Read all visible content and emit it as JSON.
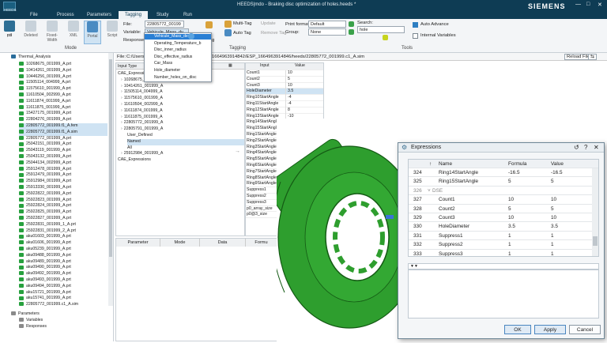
{
  "app": {
    "title": "HEEDS|mdo - Braking disc optimization of holes.heeds *",
    "logo_text": "HEEDS",
    "brand": "SIEMENS",
    "colors": {
      "titlebar": "#0e3c54",
      "accent": "#2a7fd4",
      "model": "#2e9e2e"
    }
  },
  "menu": {
    "tabs": [
      "File",
      "Process",
      "Parameters",
      "Tagging",
      "Study",
      "Run"
    ],
    "active": "Tagging"
  },
  "ribbon": {
    "mode": {
      "label": "Mode",
      "buttons": [
        "Deleted",
        "Fixed-Width",
        "XML",
        "Portal",
        "Script"
      ],
      "selected": "Portal",
      "left_buttons": [
        "rdi",
        "pxl"
      ]
    },
    "tagging": {
      "label": "Tagging",
      "file_label": "File:",
      "file_value": "22805772_00199",
      "variable_label": "Variable:",
      "variable_value": "Vehicule_Mass_dv",
      "response_label": "Response:",
      "tag_buttons": [
        "Tag",
        "Multi-Tag",
        "Update",
        "Auto Tag",
        "Remove Tag"
      ]
    },
    "tools": {
      "label": "Tools",
      "print_format_label": "Print format:",
      "print_format_value": "Default",
      "group_label": "Group:",
      "group_value": "None",
      "search_label": "Search:",
      "search_value": "hole",
      "auto_advance": "Auto Advance",
      "internal_variables": "Internal Variables"
    }
  },
  "dropdown": {
    "items": [
      "Vehicule_Mass_desi",
      "Operating_Temperature_b",
      "Disc_inner_radius",
      "Disc_effective_radius",
      "Car_Mass",
      "Hole_diameter",
      "Number_holes_on_disc"
    ],
    "selected": "Vehicule_Mass_desi"
  },
  "tree": {
    "root": "Thermal_Analysis",
    "items": [
      "10268675_001999_A.prt",
      "10414261_001999_A.prt",
      "10446256_001999_A.prt",
      "11505114_004999_A.prt",
      "11575610_001999_A.prt",
      "11610504_002999_A.prt",
      "11611874_001999_A.prt",
      "11611875_001999_A.prt",
      "15427175_001999_A.prt",
      "22804276_001999_A.prt",
      "22805772_001999.f1_A.fem",
      "22805772_001999.f1_A.sim",
      "22805772_001999_A.prt",
      "25042151_001999_A.prt",
      "25043119_001999_A.prt",
      "25043132_001999_A.prt",
      "25044134_002999_A.prt",
      "25912478_001999_A.prt",
      "25912479_001999_A.prt",
      "25912984_001999_A.prt",
      "25913330_001999_A.prt",
      "25922822_001999_A.prt",
      "25922823_001999_A.prt",
      "25922824_001999_A.prt",
      "25922825_001999_A.prt",
      "25922827_001999_A.prt",
      "25922831_001999_1_A.prt",
      "25922831_001999_2_A.prt",
      "aku01603_001999_A.prt",
      "aku01606_001999_A.prt",
      "aku05239_001999_A.prt",
      "aku09488_001999_A.prt",
      "aku09489_001999_A.prt",
      "aku09490_001999_A.prt",
      "aku09492_001999_A.prt",
      "aku09493_001999_A.prt",
      "aku09494_001999_A.prt",
      "aku15721_001999_A.prt",
      "aku15741_001999_A.prt",
      "22805772_001999.c1_A.sim"
    ],
    "bottom": [
      "Parameters",
      "Variables",
      "Responses"
    ]
  },
  "filebar": {
    "label": "File:",
    "path": "C:/Users/f",
    "path_rest": "1664963914842/ESP_1664963914846/heeds/22805772_001999.c1_A.sim",
    "reload": "Reload File"
  },
  "inputtype": {
    "header": "Input Type",
    "items": [
      "CAE_Expressions",
      "10268675_001999_A",
      "10414261_001999_A",
      "11505114_004999_A",
      "11575610_001999_A",
      "11610504_002999_A",
      "11611874_001999_A",
      "11611875_001999_A",
      "22805772_001999_A",
      "22805791_001999_A",
      "User_Defined",
      "Named",
      "All",
      "25912984_001999_A",
      "CAE_Expressions"
    ]
  },
  "inputtable": {
    "headers": [
      "Input",
      "Value"
    ],
    "rows": [
      [
        "Count1",
        "10"
      ],
      [
        "Count2",
        "5"
      ],
      [
        "Count3",
        "10"
      ],
      [
        "HoleDiameter",
        "3.5"
      ],
      [
        "Ring10StartAngle",
        "-4"
      ],
      [
        "Ring11StartAngle",
        "-4"
      ],
      [
        "Ring12StartAngle",
        "8"
      ],
      [
        "Ring13StartAngle",
        "-10"
      ],
      [
        "Ring14StartAngle",
        "-16.5"
      ],
      [
        "Ring15StartAngle",
        "5"
      ],
      [
        "Ring1StartAngle",
        ""
      ],
      [
        "Ring2StartAngle",
        ""
      ],
      [
        "Ring3StartAngle",
        ""
      ],
      [
        "Ring4StartAngle",
        ""
      ],
      [
        "Ring5StartAngle",
        ""
      ],
      [
        "Ring6StartAngle",
        ""
      ],
      [
        "Ring7StartAngle",
        ""
      ],
      [
        "Ring8StartAngle",
        ""
      ],
      [
        "Ring9StartAngle",
        ""
      ],
      [
        "Suppress1",
        ""
      ],
      [
        "Suppress2",
        ""
      ],
      [
        "Suppress3",
        ""
      ],
      [
        "p0_array_size",
        ""
      ],
      [
        "p0@3_size",
        ""
      ]
    ]
  },
  "bottomtable": {
    "headers": [
      "Parameter",
      "Mode",
      "Data",
      "Formu"
    ]
  },
  "dialog": {
    "title": "Expressions",
    "headers": [
      "Name",
      "Formula",
      "Value"
    ],
    "rows": [
      [
        "324",
        "Ring14StartAngle",
        "-16.5",
        "-16.5"
      ],
      [
        "325",
        "Ring15StartAngle",
        "5",
        "5"
      ],
      [
        "326",
        "DSE",
        "",
        ""
      ],
      [
        "327",
        "Count1",
        "10",
        "10"
      ],
      [
        "328",
        "Count2",
        "5",
        "5"
      ],
      [
        "329",
        "Count3",
        "10",
        "10"
      ],
      [
        "330",
        "HoleDiameter",
        "3.5",
        "3.5"
      ],
      [
        "331",
        "Suppress1",
        "1",
        "1"
      ],
      [
        "332",
        "Suppress2",
        "1",
        "1"
      ],
      [
        "333",
        "Suppress3",
        "1",
        "1"
      ]
    ],
    "ok": "OK",
    "apply": "Apply",
    "cancel": "Cancel"
  }
}
